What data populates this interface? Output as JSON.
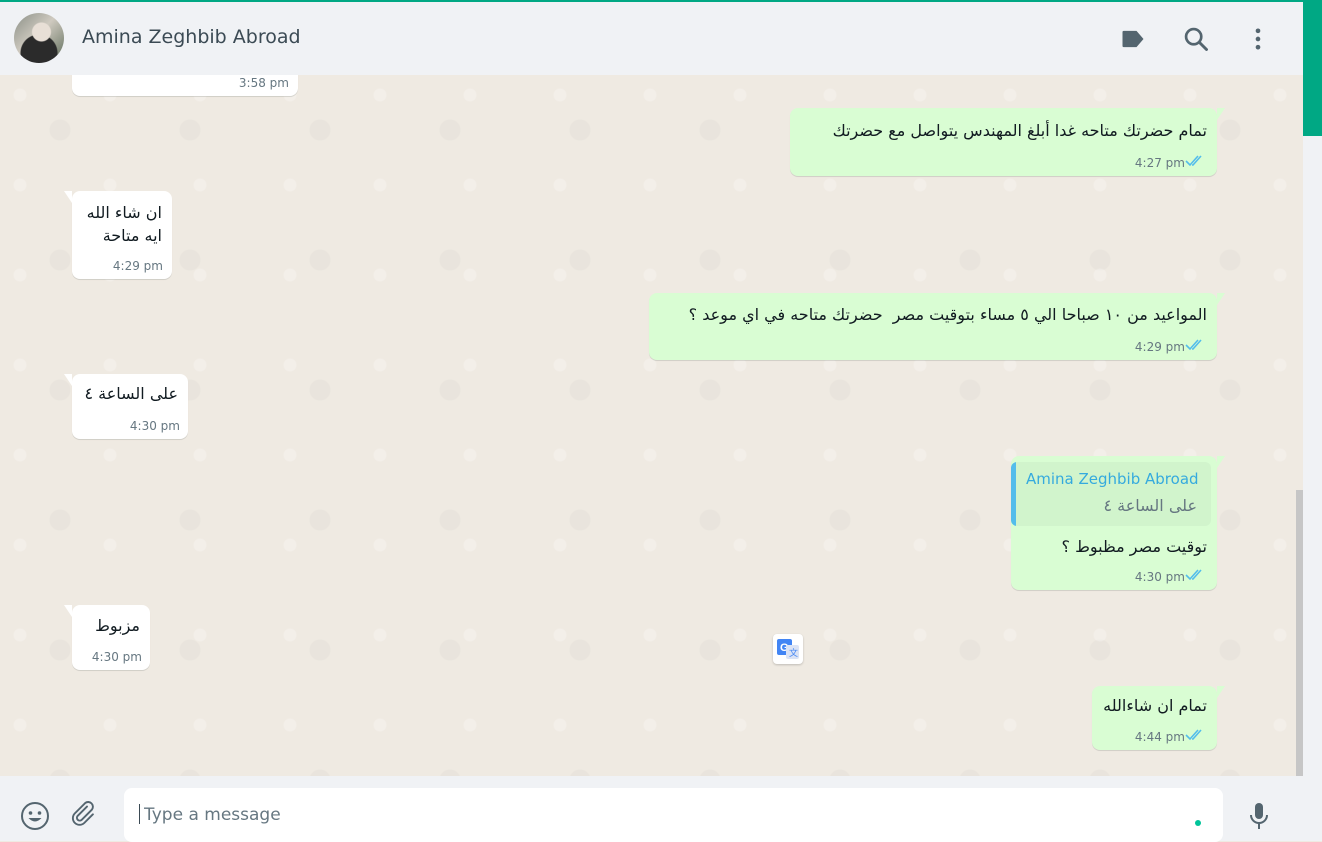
{
  "header": {
    "contact_name": "Amina Zeghbib Abroad",
    "icons": [
      "label-icon",
      "search-icon",
      "menu-icon"
    ]
  },
  "messages": [
    {
      "direction": "in",
      "text": "",
      "time": "3:58 pm"
    },
    {
      "direction": "out",
      "text": "تمام حضرتك متاحه غدا أبلغ المهندس يتواصل مع حضرتك",
      "time": "4:27 pm",
      "status": "read"
    },
    {
      "direction": "in",
      "text": "ان شاء الله\nايه متاحة",
      "time": "4:29 pm"
    },
    {
      "direction": "out",
      "text": "المواعيد من ١٠ صباحا الي ٥ مساء بتوقيت مصر  حضرتك متاحه في اي موعد ؟",
      "time": "4:29 pm",
      "status": "read"
    },
    {
      "direction": "in",
      "text": "على الساعة ٤",
      "time": "4:30 pm"
    },
    {
      "direction": "out",
      "text": "توقيت مصر مظبوط ؟",
      "time": "4:30 pm",
      "status": "read",
      "quoted": {
        "author": "Amina Zeghbib Abroad",
        "text": "على الساعة ٤"
      }
    },
    {
      "direction": "in",
      "text": "مزبوط",
      "time": "4:30 pm"
    },
    {
      "direction": "out",
      "text": "تمام ان شاءالله",
      "time": "4:44 pm",
      "status": "read"
    }
  ],
  "composer": {
    "placeholder": "Type a message",
    "icons": [
      "emoji-icon",
      "attach-icon",
      "microphone-icon"
    ]
  },
  "colors": {
    "accent": "#00a884",
    "outgoing_bubble": "#d9fdd3",
    "incoming_bubble": "#ffffff",
    "read_ticks": "#53bdeb",
    "background": "#efeae2"
  }
}
